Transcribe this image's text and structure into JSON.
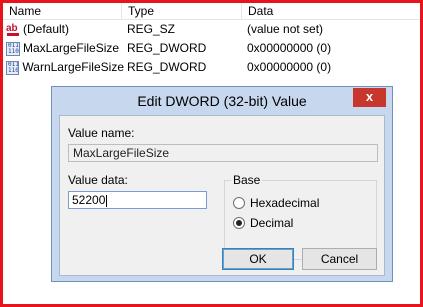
{
  "list": {
    "columns": [
      "Name",
      "Type",
      "Data"
    ],
    "rows": [
      {
        "icon": "string-value-icon",
        "name": "(Default)",
        "type": "REG_SZ",
        "data": "(value not set)"
      },
      {
        "icon": "binary-value-icon",
        "name": "MaxLargeFileSize",
        "type": "REG_DWORD",
        "data": "0x00000000 (0)"
      },
      {
        "icon": "binary-value-icon",
        "name": "WarnLargeFileSize",
        "type": "REG_DWORD",
        "data": "0x00000000 (0)"
      }
    ]
  },
  "dialog": {
    "title": "Edit DWORD (32-bit) Value",
    "close_label": "x",
    "value_name_label": "Value name:",
    "value_name": "MaxLargeFileSize",
    "value_data_label": "Value data:",
    "value_data": "52200",
    "base_label": "Base",
    "hex_label": "Hexadecimal",
    "dec_label": "Decimal",
    "selected_base": "Decimal",
    "ok_label": "OK",
    "cancel_label": "Cancel"
  },
  "colors": {
    "frame": "#e8141c",
    "dialog_bg": "#c7d8ee",
    "close": "#c7372d"
  }
}
